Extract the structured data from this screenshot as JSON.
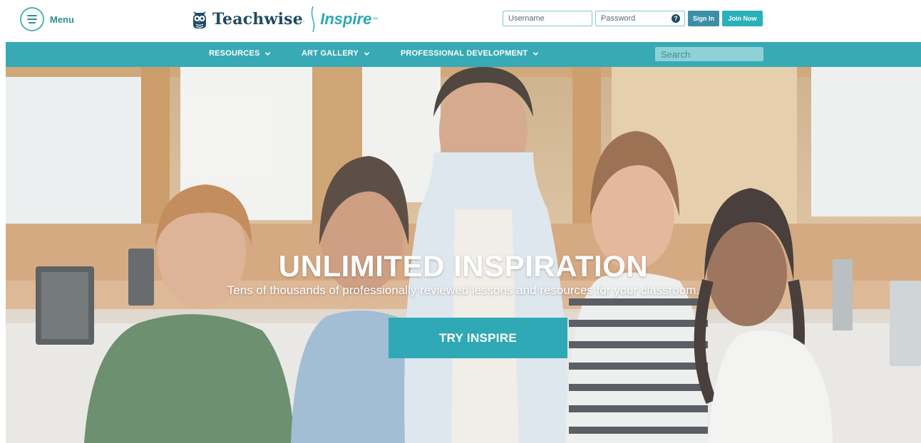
{
  "header": {
    "menu_label": "Menu",
    "logo": {
      "brand": "Teachwise",
      "brand_mark": ".",
      "product": "Inspire",
      "tm": "™"
    },
    "login": {
      "username_placeholder": "Username",
      "password_placeholder": "Password",
      "help_glyph": "?",
      "signin_label": "Sign In",
      "join_label": "Join Now"
    }
  },
  "nav": {
    "items": [
      {
        "label": "RESOURCES"
      },
      {
        "label": "ART GALLERY"
      },
      {
        "label": "PROFESSIONAL DEVELOPMENT"
      }
    ],
    "search_placeholder": "Search"
  },
  "hero": {
    "title": "UNLIMITED INSPIRATION",
    "subtitle": "Tens of thousands of professionally reviewed lessons and resources for your classroom.",
    "cta_label": "TRY INSPIRE"
  },
  "colors": {
    "accent": "#37aab6",
    "navy": "#1f4a63",
    "cta": "#2fa9b5"
  },
  "icons": {
    "menu": "hamburger-icon",
    "logo": "owl-icon",
    "help": "question-icon",
    "chevron": "chevron-down-icon",
    "search": "search-icon"
  }
}
